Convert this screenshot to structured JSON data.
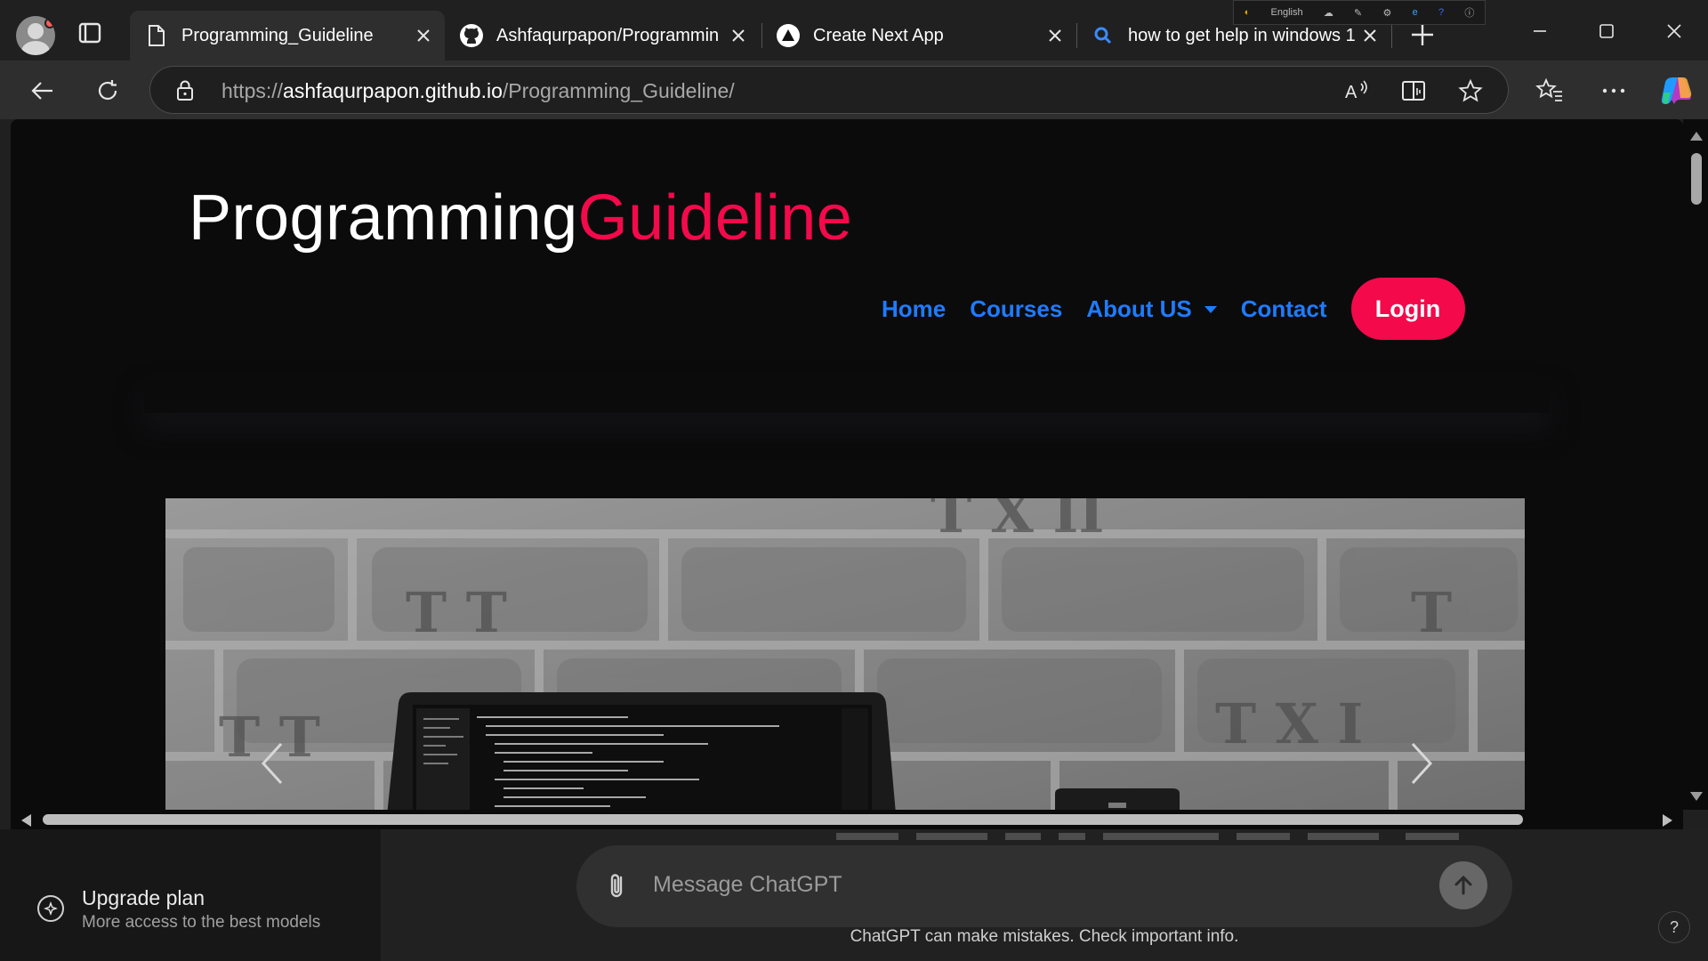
{
  "browser": {
    "tabs": [
      {
        "title": "Programming_Guideline",
        "favicon": "page-icon",
        "active": true
      },
      {
        "title": "Ashfaqurpapon/Programmin",
        "favicon": "github-icon",
        "active": false
      },
      {
        "title": "Create Next App",
        "favicon": "vercel-triangle-icon",
        "active": false
      },
      {
        "title": "how to get help in windows 1",
        "favicon": "search-icon",
        "active": false
      }
    ],
    "language_widget": "English",
    "url": {
      "scheme": "https://",
      "host": "ashfaqurpapon.github.io",
      "path": "/Programming_Guideline/"
    }
  },
  "site": {
    "brand_main": "Programming",
    "brand_accent": "Guideline",
    "nav": {
      "home": "Home",
      "courses": "Courses",
      "about": "About US",
      "contact": "Contact",
      "login": "Login"
    }
  },
  "chatgpt": {
    "upgrade_title": "Upgrade plan",
    "upgrade_sub": "More access to the best models",
    "composer_placeholder": "Message ChatGPT",
    "disclaimer": "ChatGPT can make mistakes. Check important info.",
    "help": "?"
  },
  "colors": {
    "accent": "#f4094b",
    "nav_link": "#1f7bff",
    "page_bg": "#0b0b0c",
    "browser_chrome": "#2e2e2e"
  }
}
